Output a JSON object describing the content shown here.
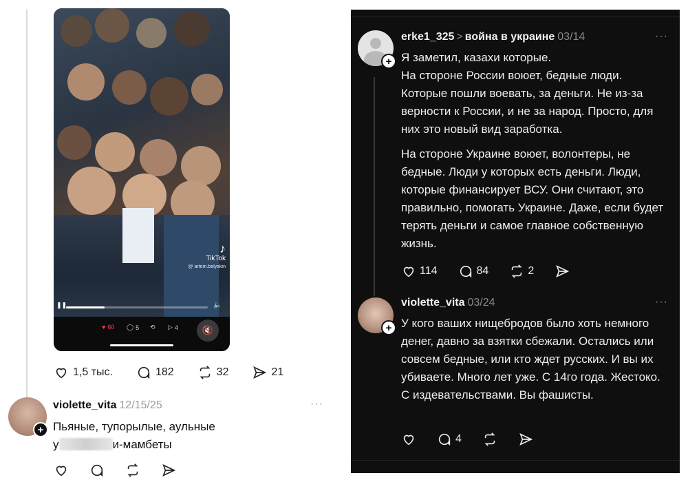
{
  "left_post": {
    "video": {
      "watermark_brand": "TikTok",
      "watermark_handle": "@ artem.belyakin",
      "progress": 0.27,
      "mini_likes": "60",
      "mini_comments": "5",
      "mini_shares": "4"
    },
    "actions": {
      "likes": "1,5 тыс.",
      "comments": "182",
      "reposts": "32",
      "shares": "21"
    }
  },
  "left_reply": {
    "author": "violette_vita",
    "date": "12/15/25",
    "more": "···",
    "line1": "Пьяные, тупорылые, аульные",
    "line2_start": "у",
    "line2_end": "и-мамбеты"
  },
  "right_post": {
    "author": "erke1_325",
    "separator": ">",
    "topic": "война в украине",
    "date": "03/14",
    "more": "···",
    "paragraph1": "Я заметил, казахи которые.\nНа стороне России воюет, бедные люди. Которые пошли воевать, за деньги. Не из-за верности к России, и не за народ. Просто, для них это новый вид заработка.",
    "paragraph2": "На стороне Украине воюет, волонтеры, не бедные. Люди у которых есть деньги. Люди, которые финансирует ВСУ. Они считают, это правильно, помогать Украине. Даже, если будет терять деньги и самое главное собственную жизнь.",
    "actions": {
      "likes": "114",
      "comments": "84",
      "reposts": "2"
    }
  },
  "right_reply": {
    "author": "violette_vita",
    "date": "03/24",
    "more": "···",
    "text": "У кого ваших нищебродов было хоть немного денег, давно за взятки сбежали. Остались или совсем бедные, или кто ждет русских. И вы их убиваете. Много лет уже. С 14го года. Жестоко. С издевательствами. Вы фашисты.",
    "actions": {
      "comments": "4"
    }
  },
  "icons": [
    "heart-icon",
    "comment-icon",
    "repost-icon",
    "share-icon",
    "plus-icon",
    "more-icon",
    "mute-icon",
    "volume-icon"
  ]
}
